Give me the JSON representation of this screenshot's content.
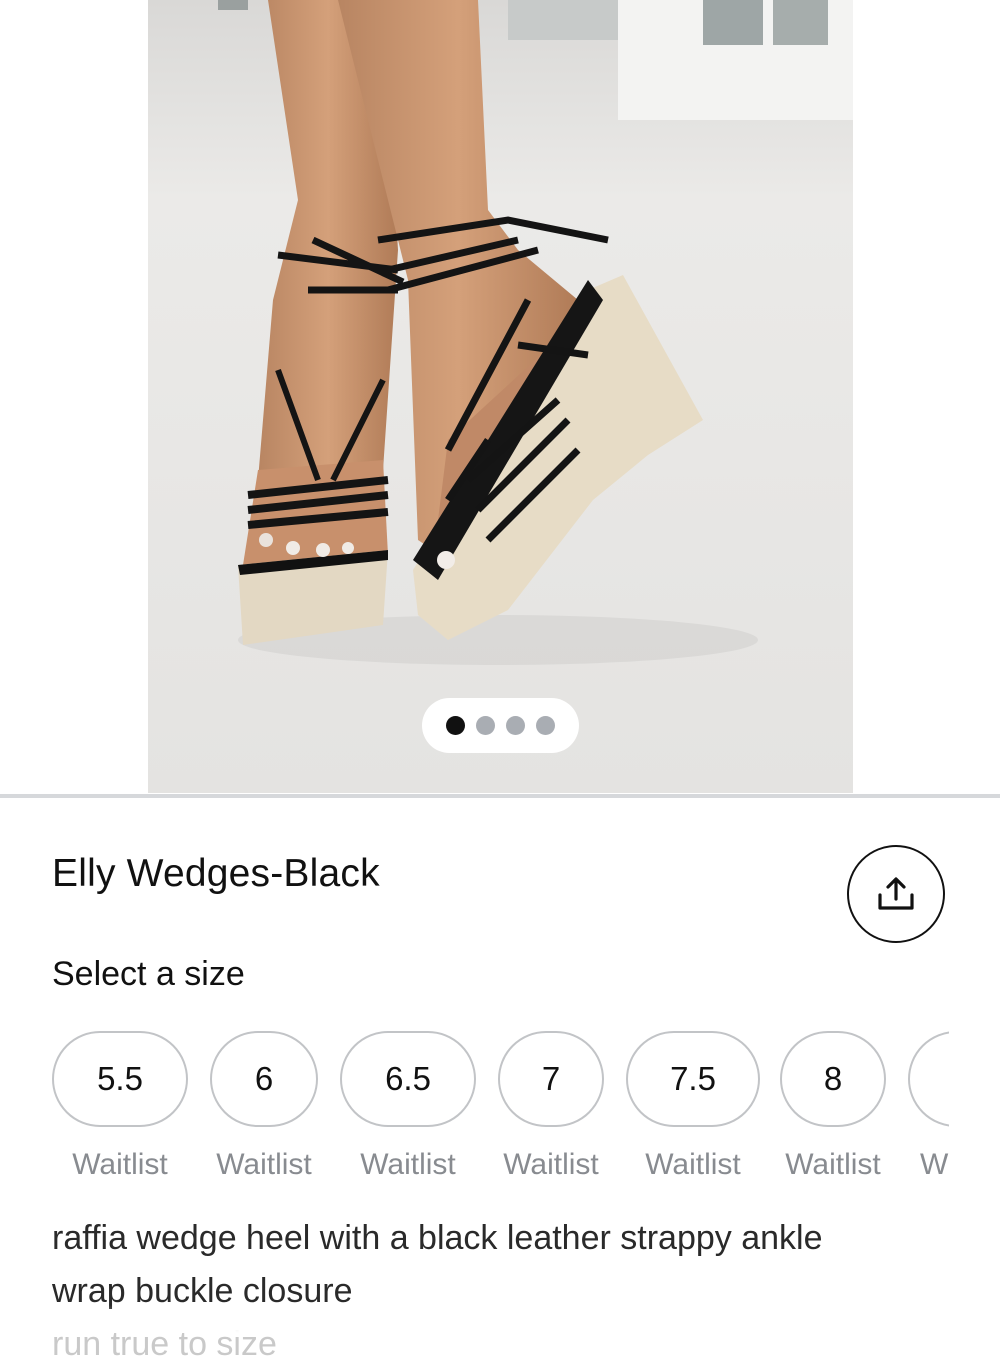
{
  "product": {
    "title": "Elly Wedges-Black",
    "image_alt": "Woman wearing black strappy raffia wedge sandals",
    "carousel": {
      "count": 4,
      "active": 0
    }
  },
  "share": {
    "icon": "share-icon"
  },
  "sizes": {
    "label": "Select a size",
    "options": [
      {
        "size": "5.5",
        "status": "Waitlist"
      },
      {
        "size": "6",
        "status": "Waitlist"
      },
      {
        "size": "6.5",
        "status": "Waitlist"
      },
      {
        "size": "7",
        "status": "Waitlist"
      },
      {
        "size": "7.5",
        "status": "Waitlist"
      },
      {
        "size": "8",
        "status": "Waitlist"
      },
      {
        "size": "",
        "status": "W"
      }
    ]
  },
  "description": {
    "line1": "raffia wedge heel with a black leather strappy ankle",
    "line2": "wrap buckle closure",
    "line3": "run true to size"
  },
  "colors": {
    "text": "#111111",
    "muted": "#888b90",
    "pill_border": "#c2c4c7",
    "dot_active": "#111111",
    "dot_inactive": "#a9adb3"
  }
}
